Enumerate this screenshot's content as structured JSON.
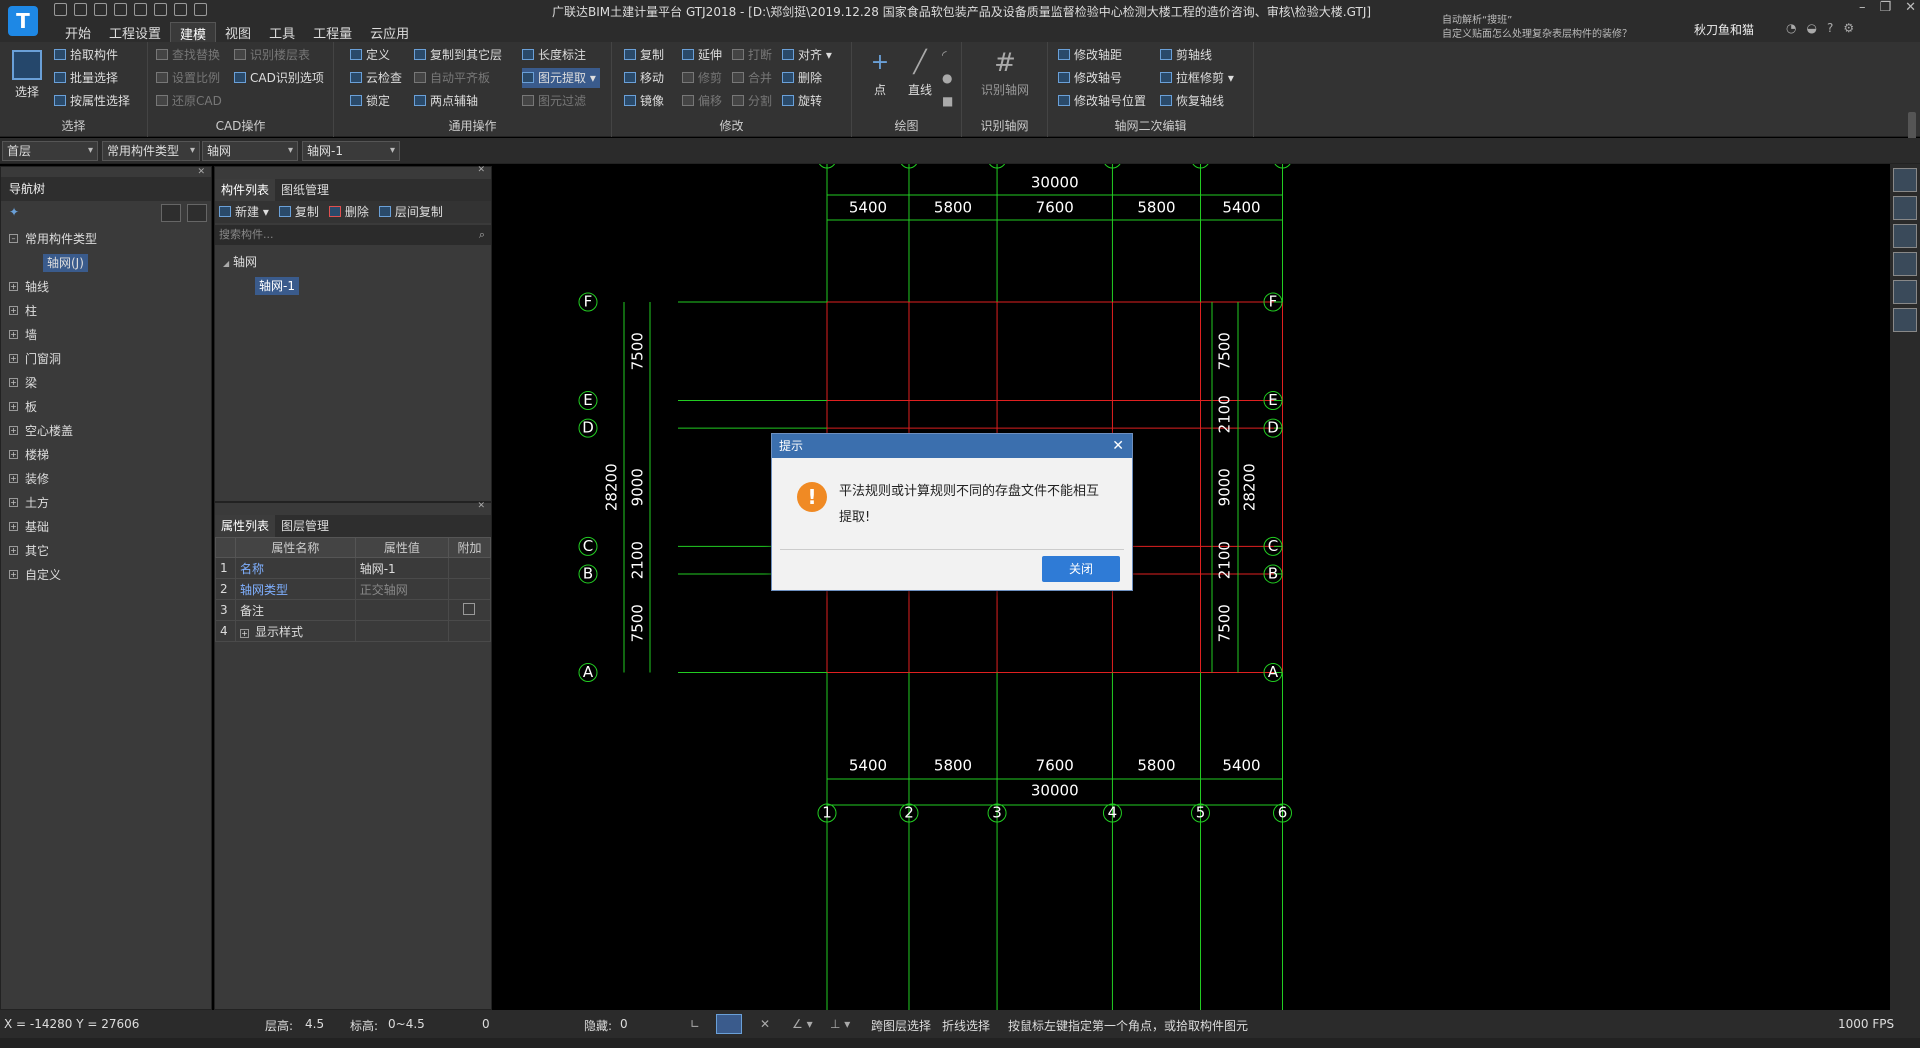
{
  "app": {
    "logo": "T",
    "title": "广联达BIM土建计量平台 GTJ2018 - [D:\\郑剑挺\\2019.12.28 国家食品软包装产品及设备质量监督检验中心检测大楼工程的造价咨询、审核\\检验大楼.GTJ]",
    "user": "秋刀鱼和猫",
    "note1": "自动解析“搜班”",
    "note2": "自定义贴面怎么处理复杂表层构件的装修？"
  },
  "tabs": [
    "开始",
    "工程设置",
    "建模",
    "视图",
    "工具",
    "工程量",
    "云应用"
  ],
  "ribbon": {
    "select": {
      "big": "选择",
      "items": [
        "拾取构件",
        "批量选择",
        "按属性选择"
      ],
      "label": "选择"
    },
    "cad": {
      "items": [
        "查找替换",
        "识别楼层表",
        "设置比例",
        "CAD识别选项",
        "还原CAD"
      ],
      "label": "CAD操作"
    },
    "common": {
      "items": [
        "定义",
        "复制到其它层",
        "长度标注",
        "云检查",
        "自动平齐板",
        "图元提取",
        "锁定",
        "两点辅轴",
        "图元过滤"
      ],
      "label": "通用操作"
    },
    "modify": {
      "items": [
        "复制",
        "延伸",
        "打断",
        "对齐",
        "移动",
        "修剪",
        "合并",
        "删除",
        "镜像",
        "偏移",
        "分割",
        "旋转"
      ],
      "label": "修改"
    },
    "draw": {
      "items": [
        "点",
        "直线"
      ],
      "label": "绘图"
    },
    "identify": {
      "big": "识别轴网",
      "label": "识别轴网"
    },
    "axisedit": {
      "items": [
        "修改轴距",
        "剪轴线",
        "修改轴号",
        "拉框修剪",
        "修改轴号位置",
        "恢复轴线"
      ],
      "label": "轴网二次编辑"
    }
  },
  "selectors": [
    "首层",
    "常用构件类型",
    "轴网",
    "轴网-1"
  ],
  "nav": {
    "title": "导航树",
    "root": "常用构件类型",
    "child": "轴网(J)",
    "items": [
      "轴线",
      "柱",
      "墙",
      "门窗洞",
      "梁",
      "板",
      "空心楼盖",
      "楼梯",
      "装修",
      "土方",
      "基础",
      "其它",
      "自定义"
    ]
  },
  "complist": {
    "tabs": [
      "构件列表",
      "图纸管理"
    ],
    "tools": [
      "新建",
      "复制",
      "删除",
      "层间复制"
    ],
    "search": "搜索构件...",
    "group": "轴网",
    "item": "轴网-1"
  },
  "props": {
    "tabs": [
      "属性列表",
      "图层管理"
    ],
    "headers": [
      "属性名称",
      "属性值",
      "附加"
    ],
    "rows": [
      {
        "n": "1",
        "k": "名称",
        "v": "轴网-1"
      },
      {
        "n": "2",
        "k": "轴网类型",
        "v": "正交轴网"
      },
      {
        "n": "3",
        "k": "备注",
        "v": ""
      },
      {
        "n": "4",
        "k": "显示样式",
        "v": ""
      }
    ]
  },
  "grid": {
    "cols": [
      "1",
      "2",
      "3",
      "4",
      "5",
      "6"
    ],
    "rows": [
      "F",
      "E",
      "D",
      "C",
      "B",
      "A"
    ],
    "col_spacings": [
      5400,
      5800,
      7600,
      5800,
      5400
    ],
    "total_x": "30000",
    "row_spacings": [
      7500,
      2100,
      9000,
      2100,
      7500
    ],
    "left_spacing_labels": [
      "7500",
      "9000",
      "2100",
      "7500"
    ],
    "total_y": "28200",
    "colors": {
      "axis": "#e02020",
      "dim": "#22cc22",
      "text": "#ffffff"
    }
  },
  "dialog": {
    "title": "提示",
    "icon": "warning-icon",
    "message": "平法规则或计算规则不同的存盘文件不能相互提取!",
    "button": "关闭"
  },
  "status": {
    "coords": "X = -14280 Y = 27606",
    "floor_h": "层高:",
    "floor_v": "4.5",
    "elev": "标高:",
    "elev_v": "0~4.5",
    "zero": "0",
    "hidden": "隐藏:",
    "hidden_v": "0",
    "cross": "跨图层选择",
    "poly": "折线选择",
    "hint": "按鼠标左键指定第一个角点，或拾取构件图元",
    "fps": "1000 FPS"
  }
}
